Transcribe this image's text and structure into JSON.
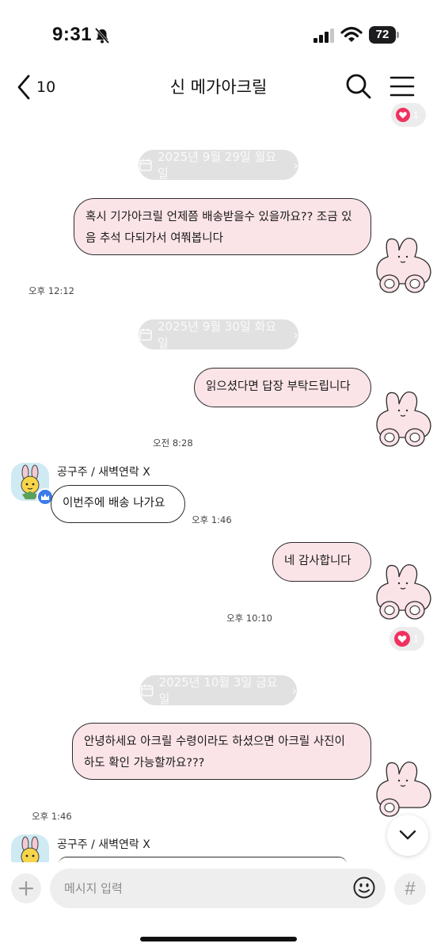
{
  "status_bar": {
    "time": "9:31",
    "battery": "72",
    "icons": [
      "bell-slash-icon",
      "signal-icon",
      "wifi-icon",
      "battery-icon"
    ]
  },
  "header": {
    "back_count": "10",
    "title": "신 메가아크릴",
    "icons": [
      "chevron-left-icon",
      "search-icon",
      "menu-icon"
    ]
  },
  "reactions": {
    "top_count": "1",
    "second_count": "1",
    "heart_color": "#f0315f"
  },
  "dates": {
    "d1": "2025년 9월 29일 월요일",
    "d2": "2025년 9월 30일 화요일",
    "d3": "2025년 10월 3일 금요일"
  },
  "messages": {
    "m1": {
      "line1": "혹시 기가아크릴 언제쯤 배송받을수 있을까요?? 조금 있",
      "line2": "음 추석 다되가서 여쭤봅니다",
      "time": "오후 12:12"
    },
    "m2": {
      "text": "읽으셨다면 답장 부탁드립니다",
      "time": "오전 8:28"
    },
    "m3": {
      "sender": "공구주 / 새벽연락 X",
      "text": "이번주에 배송 나가요",
      "time": "오후 1:46"
    },
    "m4": {
      "text": "네 감사합니다",
      "time": "오후 10:10"
    },
    "m5": {
      "line1": "안녕하세요 아크릴 수령이라도 하셨으면 아크릴 사진이",
      "line2": "하도 확인 가능할까요???",
      "time": "오후 1:46"
    },
    "m6": {
      "sender": "공구주 / 새벽연락 X"
    }
  },
  "colors": {
    "my_bubble": "#fbe4e8",
    "their_bubble": "#ffffff",
    "date_pill": "#e1e1e1"
  },
  "input": {
    "placeholder": "메시지 입력",
    "hash": "#"
  }
}
